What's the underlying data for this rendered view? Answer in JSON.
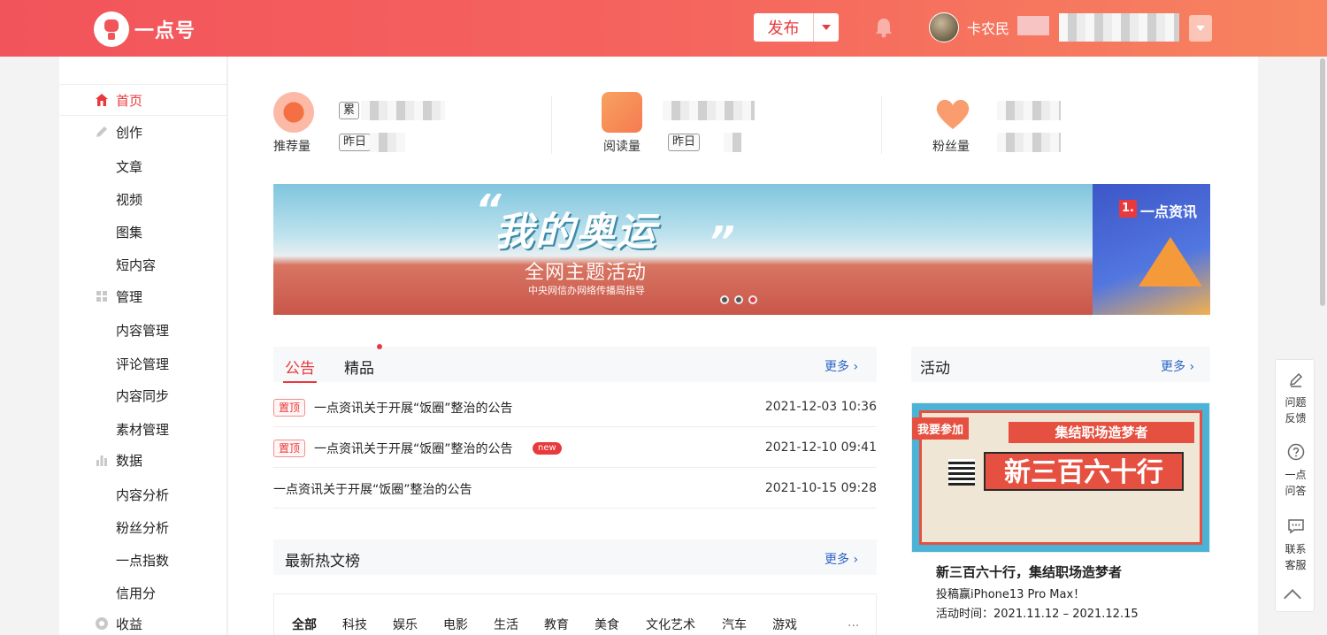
{
  "header": {
    "logo_text": "一点号",
    "publish_label": "发布",
    "username": "卡农民"
  },
  "sidebar": {
    "items": [
      {
        "label": "首页",
        "icon": "home-icon"
      },
      {
        "label": "创作",
        "icon": "pencil-icon"
      },
      {
        "label": "文章"
      },
      {
        "label": "视频"
      },
      {
        "label": "图集"
      },
      {
        "label": "短内容"
      },
      {
        "label": "管理",
        "icon": "grid-icon"
      },
      {
        "label": "内容管理"
      },
      {
        "label": "评论管理"
      },
      {
        "label": "内容同步"
      },
      {
        "label": "素材管理"
      },
      {
        "label": "数据",
        "icon": "bar-chart-icon"
      },
      {
        "label": "内容分析"
      },
      {
        "label": "粉丝分析"
      },
      {
        "label": "一点指数"
      },
      {
        "label": "信用分"
      },
      {
        "label": "收益",
        "icon": "coin-icon"
      }
    ]
  },
  "stats": [
    {
      "label": "推荐量",
      "tag1": "累",
      "tag2": "昨日"
    },
    {
      "label": "阅读量",
      "tag2": "昨日"
    },
    {
      "label": "粉丝量"
    }
  ],
  "banner": {
    "title": "我的奥运",
    "subtitle": "全网主题活动",
    "subtitle2": "中央网信办网络传播局指导",
    "side_badge": "1.",
    "side_text": "一点资讯"
  },
  "notices": {
    "tabs": [
      "公告",
      "精品"
    ],
    "more": "更多",
    "pin_label": "置顶",
    "new_label": "new",
    "rows": [
      {
        "title": "一点资讯关于开展“饭圈”整治的公告",
        "date": "2021-12-03 10:36"
      },
      {
        "title": "一点资讯关于开展“饭圈”整治的公告",
        "date": "2021-12-10 09:41"
      },
      {
        "title": "一点资讯关于开展“饭圈”整治的公告",
        "date": "2021-10-15 09:28"
      }
    ]
  },
  "hot": {
    "title": "最新热文榜",
    "more": "更多",
    "categories": [
      "全部",
      "科技",
      "娱乐",
      "电影",
      "生活",
      "教育",
      "美食",
      "文化艺术",
      "汽车",
      "游戏",
      "..."
    ]
  },
  "activity": {
    "title": "活动",
    "more": "更多",
    "join": "我要参加",
    "img_title": "集结职场造梦者",
    "img_big": "新三百六十行",
    "card_title": "新三百六十行，集结职场造梦者",
    "card_line1": "投稿赢iPhone13 Pro Max！",
    "card_line2": "活动时间：2021.11.12 – 2021.12.15"
  },
  "float_bar": {
    "feedback": [
      "问题",
      "反馈"
    ],
    "qa": [
      "一点",
      "问答"
    ],
    "service": [
      "联系",
      "客服"
    ]
  },
  "colors": {
    "brand": "#e8393c",
    "link": "#2a64c5"
  }
}
